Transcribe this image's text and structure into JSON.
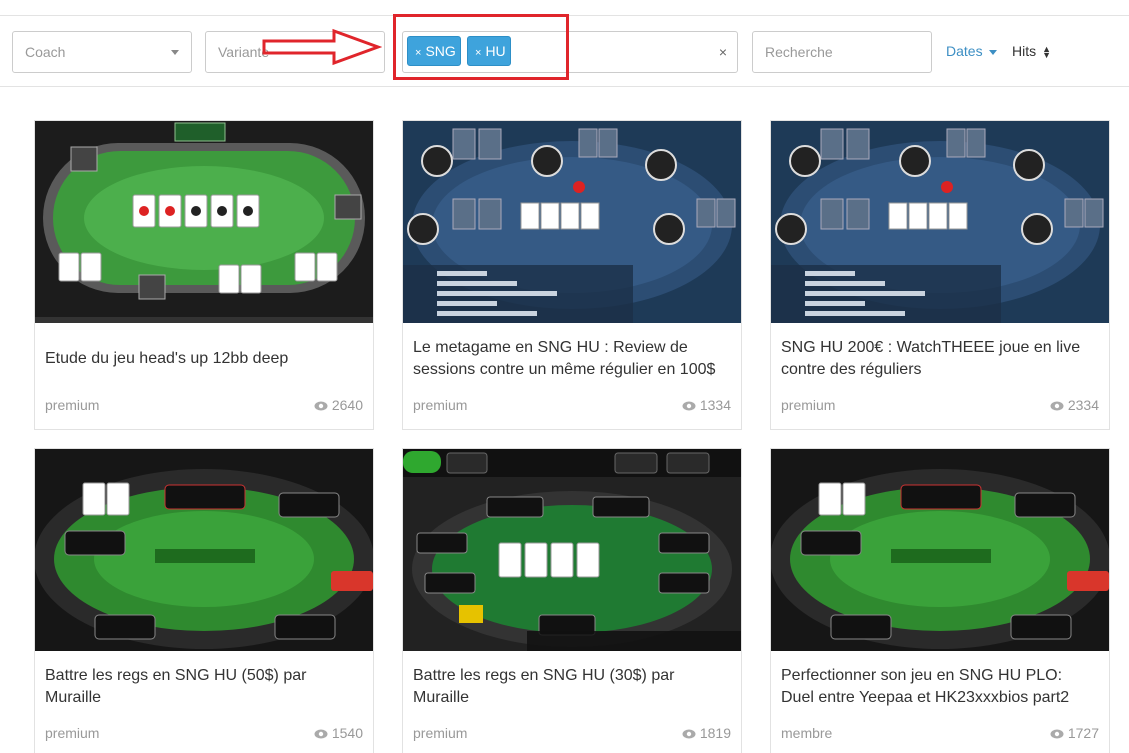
{
  "filters": {
    "coach_placeholder": "Coach",
    "variante_placeholder": "Variante",
    "tags": [
      "SNG",
      "HU"
    ],
    "tag_remove_glyph": "×",
    "clear_glyph": "×",
    "search_placeholder": "Recherche",
    "sort_dates_label": "Dates",
    "sort_hits_label": "Hits"
  },
  "icons": {
    "caret": "caret-down-icon",
    "sort": "sort-updown-icon",
    "eye": "eye-icon"
  },
  "colors": {
    "accent": "#3ea3dc",
    "annotation": "#e0252b",
    "felt_green": "#2f8a2f",
    "felt_blue": "#2c4d73"
  },
  "cards": [
    {
      "title": "Etude du jeu head's up 12bb deep",
      "level": "premium",
      "views": "2640",
      "thumb": "green-table"
    },
    {
      "title": "Le metagame en SNG HU : Review de sessions contre un même régulier en 100$",
      "level": "premium",
      "views": "1334",
      "thumb": "blue-table"
    },
    {
      "title": "SNG HU 200€ : WatchTHEEE joue en live contre des réguliers",
      "level": "premium",
      "views": "2334",
      "thumb": "blue-table"
    },
    {
      "title": "Battre les regs en SNG HU (50$) par Muraille",
      "level": "premium",
      "views": "1540",
      "thumb": "winner-table"
    },
    {
      "title": "Battre les regs en SNG HU (30$) par Muraille",
      "level": "premium",
      "views": "1819",
      "thumb": "dark-table"
    },
    {
      "title": "Perfectionner son jeu en SNG HU PLO: Duel entre Yeepaa et HK23xxxbios part2",
      "level": "membre",
      "views": "1727",
      "thumb": "winner-table"
    }
  ]
}
